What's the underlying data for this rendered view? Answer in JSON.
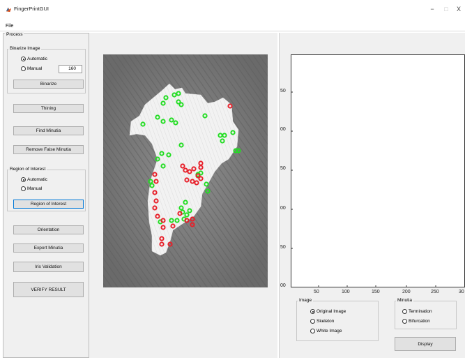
{
  "window": {
    "title": "FingerPrintGUI",
    "minimize": "−",
    "maximize": "□",
    "close": "X"
  },
  "menu": {
    "file": "File"
  },
  "process": {
    "label": "Process",
    "binarize_group": "Binarize Image",
    "automatic": "Automatic",
    "manual": "Manual",
    "threshold_value": "160",
    "binarize": "Binarize",
    "thining": "Thining",
    "find_minutia": "Find Minutia",
    "remove_false": "Remove False Minutia",
    "roi_group": "Region of Interest",
    "roi_automatic": "Automatic",
    "roi_manual": "Manual",
    "roi_button": "Region of Interest",
    "orientation": "Orientation",
    "export": "Export Minutia",
    "iris": "Iris Validation",
    "verify": "VERIFY RESULT"
  },
  "axes": {
    "y_ticks": [
      "50",
      "00",
      "50",
      "00",
      "50",
      "00"
    ],
    "x_ticks": [
      "50",
      "100",
      "150",
      "200",
      "250",
      "30"
    ]
  },
  "image_group": {
    "label": "Image",
    "options": [
      "Original Image",
      "Skeleton",
      "White Image"
    ],
    "selected": "Original Image"
  },
  "minutia_group": {
    "label": "Minutia",
    "options": [
      "Termination",
      "Bifurcation"
    ]
  },
  "display": "Display",
  "colors": {
    "termination_marker": "#e8202a",
    "bifurcation_marker": "#22dd22",
    "focus_border": "#0078d7"
  }
}
